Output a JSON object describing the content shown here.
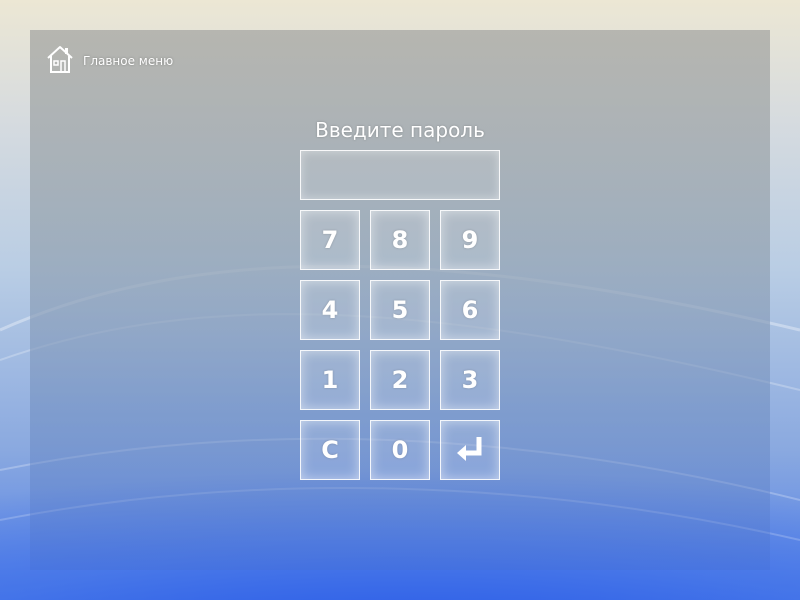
{
  "header": {
    "home_label": "Главное меню",
    "home_icon": "house-icon"
  },
  "password": {
    "prompt": "Введите пароль",
    "value": ""
  },
  "keypad": {
    "rows": [
      [
        "7",
        "8",
        "9"
      ],
      [
        "4",
        "5",
        "6"
      ],
      [
        "1",
        "2",
        "3"
      ]
    ],
    "clear_label": "C",
    "zero_label": "0",
    "enter_icon": "enter-arrow-icon"
  },
  "colors": {
    "text": "#ffffff",
    "accent_blue": "#2a5fe6"
  }
}
